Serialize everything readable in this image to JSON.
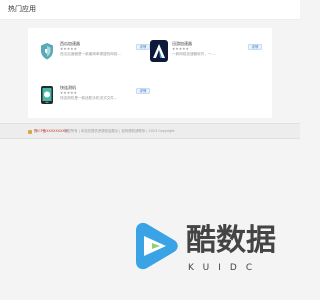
{
  "header": {
    "title": "热门应用"
  },
  "apps": [
    {
      "name": "西瓜加速器",
      "stars": "★★★★★",
      "desc": "西瓜加速器是一款最简单便捷的网络…",
      "button": "详情",
      "icon": "shield-icon",
      "icon_color": "#e9f4f2"
    },
    {
      "name": "迅游加速器",
      "stars": "★★★★★",
      "desc": "一款网络加速器软件，一…",
      "button": "详情",
      "icon": "mountain-logo-icon",
      "icon_color": "#0d1a3a"
    },
    {
      "name": "快连测机",
      "stars": "★★★★★",
      "desc": "快连测机是一款适配手机流式文件…",
      "button": "详情",
      "icon": "phone-icon",
      "icon_color": "#2d8c8a"
    }
  ],
  "footer": {
    "link": "豫ICP备XXXXXXXX号",
    "copyright": "版权所有 | 本站仅提供资源信息展示 | 如有侵权请联系 | 2023 Copyright"
  },
  "watermark": {
    "main": "酷数据",
    "sub": "KUIDC"
  }
}
